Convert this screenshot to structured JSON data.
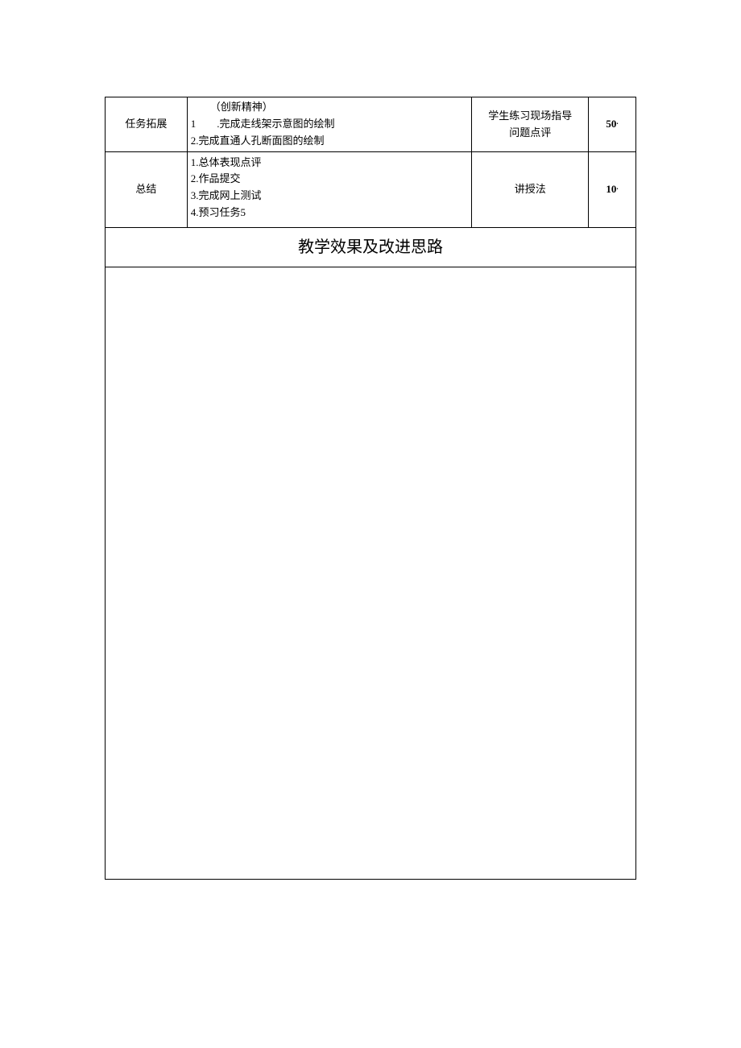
{
  "rows": {
    "expand": {
      "label": "任务拓展",
      "content_line1": "（创新精神）",
      "content_line2_num": "1",
      "content_line2_text": ".完成走线架示意图的绘制",
      "content_line3": "2.完成直通人孔断面图的绘制",
      "method_line1": "学生练习现场指导",
      "method_line2": "问题点评",
      "num": "50"
    },
    "summary": {
      "label": "总结",
      "content_line1": "1.总体表现点评",
      "content_line2": "2.作品提交",
      "content_line3": "3.完成网上测试",
      "content_line4": "4.预习任务5",
      "method": "讲授法",
      "num": "10"
    }
  },
  "section_title": "教学效果及改进思路"
}
